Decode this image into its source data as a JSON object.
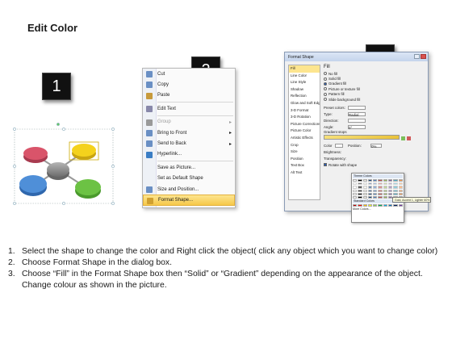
{
  "title": "Edit Color",
  "badges": [
    "1",
    "2",
    "3"
  ],
  "colors": {
    "center_node": "#8c8c8c",
    "node_red": "#d9546a",
    "node_yellow": "#f4d21c",
    "node_blue": "#4f8fd8",
    "node_green": "#6cc244",
    "menu_highlight": "#f6c84a"
  },
  "context_menu": {
    "items": [
      {
        "label": "Cut",
        "icon": "scissors-icon",
        "disabled": false,
        "submenu": false
      },
      {
        "label": "Copy",
        "icon": "copy-icon",
        "disabled": false,
        "submenu": false
      },
      {
        "label": "Paste",
        "icon": "paste-icon",
        "disabled": false,
        "submenu": false
      },
      {
        "label": "Edit Text",
        "icon": "edit-text-icon",
        "disabled": false,
        "submenu": false
      },
      {
        "label": "Group",
        "icon": "group-icon",
        "disabled": true,
        "submenu": true
      },
      {
        "label": "Bring to Front",
        "icon": "bring-front-icon",
        "disabled": false,
        "submenu": true
      },
      {
        "label": "Send to Back",
        "icon": "send-back-icon",
        "disabled": false,
        "submenu": true
      },
      {
        "label": "Hyperlink...",
        "icon": "hyperlink-icon",
        "disabled": false,
        "submenu": false
      },
      {
        "label": "Save as Picture...",
        "icon": "",
        "disabled": false,
        "submenu": false
      },
      {
        "label": "Set as Default Shape",
        "icon": "",
        "disabled": false,
        "submenu": false
      },
      {
        "label": "Size and Position...",
        "icon": "size-position-icon",
        "disabled": false,
        "submenu": false
      },
      {
        "label": "Format Shape...",
        "icon": "format-shape-icon",
        "disabled": false,
        "submenu": false,
        "highlighted": true
      }
    ]
  },
  "dialog": {
    "title": "Format Shape",
    "categories": [
      "Fill",
      "Line Color",
      "Line Style",
      "Shadow",
      "Reflection",
      "Glow and Soft Edges",
      "3-D Format",
      "3-D Rotation",
      "Picture Corrections",
      "Picture Color",
      "Artistic Effects",
      "Crop",
      "Size",
      "Position",
      "Text Box",
      "Alt Text"
    ],
    "selected_category": "Fill",
    "fill_heading": "Fill",
    "fill_options": [
      {
        "label": "No fill",
        "selected": false
      },
      {
        "label": "Solid fill",
        "selected": false
      },
      {
        "label": "Gradient fill",
        "selected": true
      },
      {
        "label": "Picture or texture fill",
        "selected": false
      },
      {
        "label": "Pattern fill",
        "selected": false
      },
      {
        "label": "Slide background fill",
        "selected": false
      }
    ],
    "preset_label": "Preset colors:",
    "type_label": "Type:",
    "type_value": "Radial",
    "direction_label": "Direction:",
    "angle_label": "Angle:",
    "angle_value": "0°",
    "gradient_stops_label": "Gradient stops",
    "color_label": "Color",
    "position_label": "Position:",
    "position_value": "0%",
    "brightness_label": "Brightness:",
    "transparency_label": "Transparency:",
    "rotate_label": "Rotate with shape",
    "palette": {
      "theme_colors_label": "Theme Colors",
      "standard_colors_label": "Standard Colors",
      "more_colors_label": "More Colors...",
      "theme_row": [
        "#ffffff",
        "#000000",
        "#eeece1",
        "#1f497d",
        "#4f81bd",
        "#c0504d",
        "#9bbb59",
        "#8064a2",
        "#4bacc6",
        "#f79646"
      ],
      "standard_row": [
        "#c00000",
        "#ff0000",
        "#ffc000",
        "#ffff00",
        "#92d050",
        "#00b050",
        "#00b0f0",
        "#0070c0",
        "#002060",
        "#7030a0"
      ]
    },
    "tooltip": "Gold, Accent 1, Lighter 60%"
  },
  "instructions": [
    {
      "num": "1.",
      "text": "Select the shape to change the color and Right click the object( click any object which you want to change color)"
    },
    {
      "num": "2.",
      "text": "Choose Format Shape in the dialog box."
    },
    {
      "num": "3.",
      "text": "Choose “Fill” in the Format Shape box then “Solid” or “Gradient” depending on the appearance of the object. Change colour as shown in the picture."
    }
  ]
}
